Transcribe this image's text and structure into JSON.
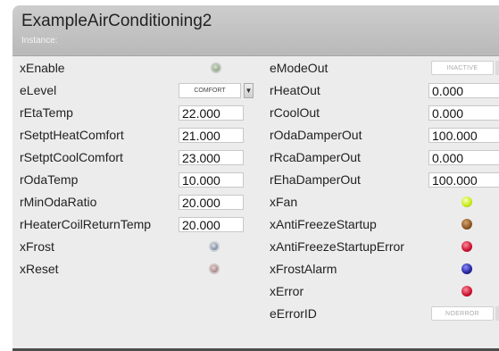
{
  "window": {
    "title": "ExampleAirConditioning2",
    "instance_label": "Instance:"
  },
  "left": {
    "xEnable": "xEnable",
    "eLevel": "eLevel",
    "eLevel_value": "COMFORT",
    "rEtaTemp": "rEtaTemp",
    "rEtaTemp_value": "22.000",
    "rSetptHeatComfort": "rSetptHeatComfort",
    "rSetptHeatComfort_value": "21.000",
    "rSetptCoolComfort": "rSetptCoolComfort",
    "rSetptCoolComfort_value": "23.000",
    "rOdaTemp": "rOdaTemp",
    "rOdaTemp_value": "10.000",
    "rMinOdaRatio": "rMinOdaRatio",
    "rMinOdaRatio_value": "20.000",
    "rHeaterCoilReturnTemp": "rHeaterCoilReturnTemp",
    "rHeaterCoilReturnTemp_value": "20.000",
    "xFrost": "xFrost",
    "xReset": "xReset"
  },
  "right": {
    "eModeOut": "eModeOut",
    "eModeOut_value": "INACTIVE",
    "rHeatOut": "rHeatOut",
    "rHeatOut_value": "0.000",
    "rCoolOut": "rCoolOut",
    "rCoolOut_value": "0.000",
    "rOdaDamperOut": "rOdaDamperOut",
    "rOdaDamperOut_value": "100.000",
    "rRcaDamperOut": "rRcaDamperOut",
    "rRcaDamperOut_value": "0.000",
    "rEhaDamperOut": "rEhaDamperOut",
    "rEhaDamperOut_value": "100.000",
    "xFan": "xFan",
    "xAntiFreezeStartup": "xAntiFreezeStartup",
    "xAntiFreezeStartupError": "xAntiFreezeStartupError",
    "xFrostAlarm": "xFrostAlarm",
    "xError": "xError",
    "eErrorID": "eErrorID",
    "eErrorID_value": "NOERROR"
  },
  "icons": {
    "dropdown_arrow": "chevron-down-icon"
  },
  "lamp_states": {
    "xEnable": "off",
    "xFrost": "off",
    "xReset": "off",
    "xFan": "on",
    "xAntiFreezeStartup": "on",
    "xAntiFreezeStartupError": "on",
    "xFrostAlarm": "on",
    "xError": "on"
  },
  "colors": {
    "header": "#c4c4c4",
    "panel": "#ececec",
    "lamp_lime": "#c9ec1b",
    "lamp_brown": "#8a5420",
    "lamp_red": "#c8102e",
    "lamp_navy": "#23239a"
  }
}
